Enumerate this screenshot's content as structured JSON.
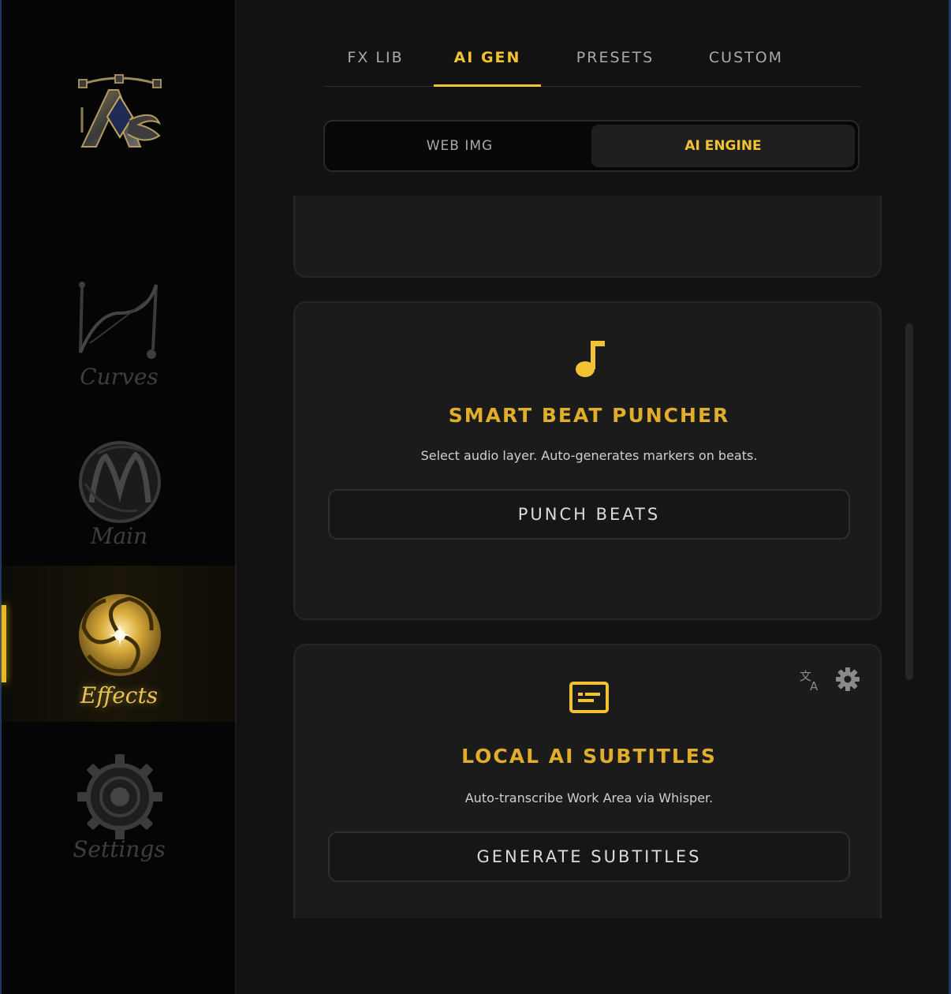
{
  "sidebar": {
    "logo_text": "AE",
    "items": [
      {
        "label": "Curves",
        "icon": "curves-icon",
        "active": false
      },
      {
        "label": "Main",
        "icon": "main-monogram-icon",
        "active": false
      },
      {
        "label": "Effects",
        "icon": "effects-swirl-icon",
        "active": true
      },
      {
        "label": "Settings",
        "icon": "settings-gear-icon",
        "active": false
      }
    ]
  },
  "tabs": [
    {
      "label": "FX LIB",
      "active": false
    },
    {
      "label": "AI GEN",
      "active": true
    },
    {
      "label": "PRESETS",
      "active": false
    },
    {
      "label": "CUSTOM",
      "active": false
    }
  ],
  "source_toggle": {
    "options": [
      "WEB IMG",
      "AI ENGINE"
    ],
    "selected": "AI ENGINE"
  },
  "cards": [
    {
      "icon": "music-note-icon",
      "title": "SMART BEAT PUNCHER",
      "description": "Select audio layer. Auto-generates markers on beats.",
      "button": "PUNCH BEATS"
    },
    {
      "icon": "subtitles-icon",
      "title": "LOCAL AI SUBTITLES",
      "description": "Auto-transcribe Work Area via Whisper.",
      "button": "GENERATE SUBTITLES",
      "extra_icons": [
        "translate-icon",
        "gear-icon"
      ]
    }
  ],
  "colors": {
    "accent": "#f1c232",
    "card_title": "#e0ae2b",
    "background": "#121212",
    "sidebar_bg": "#050505",
    "frame": "#1c3a66"
  }
}
